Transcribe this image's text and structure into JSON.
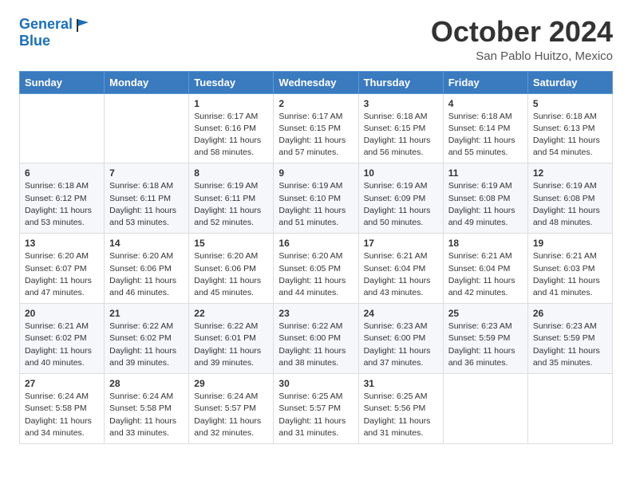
{
  "header": {
    "logo_line1": "General",
    "logo_line2": "Blue",
    "month": "October 2024",
    "location": "San Pablo Huitzo, Mexico"
  },
  "weekdays": [
    "Sunday",
    "Monday",
    "Tuesday",
    "Wednesday",
    "Thursday",
    "Friday",
    "Saturday"
  ],
  "weeks": [
    [
      {
        "day": "",
        "sunrise": "",
        "sunset": "",
        "daylight": ""
      },
      {
        "day": "",
        "sunrise": "",
        "sunset": "",
        "daylight": ""
      },
      {
        "day": "1",
        "sunrise": "Sunrise: 6:17 AM",
        "sunset": "Sunset: 6:16 PM",
        "daylight": "Daylight: 11 hours and 58 minutes."
      },
      {
        "day": "2",
        "sunrise": "Sunrise: 6:17 AM",
        "sunset": "Sunset: 6:15 PM",
        "daylight": "Daylight: 11 hours and 57 minutes."
      },
      {
        "day": "3",
        "sunrise": "Sunrise: 6:18 AM",
        "sunset": "Sunset: 6:15 PM",
        "daylight": "Daylight: 11 hours and 56 minutes."
      },
      {
        "day": "4",
        "sunrise": "Sunrise: 6:18 AM",
        "sunset": "Sunset: 6:14 PM",
        "daylight": "Daylight: 11 hours and 55 minutes."
      },
      {
        "day": "5",
        "sunrise": "Sunrise: 6:18 AM",
        "sunset": "Sunset: 6:13 PM",
        "daylight": "Daylight: 11 hours and 54 minutes."
      }
    ],
    [
      {
        "day": "6",
        "sunrise": "Sunrise: 6:18 AM",
        "sunset": "Sunset: 6:12 PM",
        "daylight": "Daylight: 11 hours and 53 minutes."
      },
      {
        "day": "7",
        "sunrise": "Sunrise: 6:18 AM",
        "sunset": "Sunset: 6:11 PM",
        "daylight": "Daylight: 11 hours and 53 minutes."
      },
      {
        "day": "8",
        "sunrise": "Sunrise: 6:19 AM",
        "sunset": "Sunset: 6:11 PM",
        "daylight": "Daylight: 11 hours and 52 minutes."
      },
      {
        "day": "9",
        "sunrise": "Sunrise: 6:19 AM",
        "sunset": "Sunset: 6:10 PM",
        "daylight": "Daylight: 11 hours and 51 minutes."
      },
      {
        "day": "10",
        "sunrise": "Sunrise: 6:19 AM",
        "sunset": "Sunset: 6:09 PM",
        "daylight": "Daylight: 11 hours and 50 minutes."
      },
      {
        "day": "11",
        "sunrise": "Sunrise: 6:19 AM",
        "sunset": "Sunset: 6:08 PM",
        "daylight": "Daylight: 11 hours and 49 minutes."
      },
      {
        "day": "12",
        "sunrise": "Sunrise: 6:19 AM",
        "sunset": "Sunset: 6:08 PM",
        "daylight": "Daylight: 11 hours and 48 minutes."
      }
    ],
    [
      {
        "day": "13",
        "sunrise": "Sunrise: 6:20 AM",
        "sunset": "Sunset: 6:07 PM",
        "daylight": "Daylight: 11 hours and 47 minutes."
      },
      {
        "day": "14",
        "sunrise": "Sunrise: 6:20 AM",
        "sunset": "Sunset: 6:06 PM",
        "daylight": "Daylight: 11 hours and 46 minutes."
      },
      {
        "day": "15",
        "sunrise": "Sunrise: 6:20 AM",
        "sunset": "Sunset: 6:06 PM",
        "daylight": "Daylight: 11 hours and 45 minutes."
      },
      {
        "day": "16",
        "sunrise": "Sunrise: 6:20 AM",
        "sunset": "Sunset: 6:05 PM",
        "daylight": "Daylight: 11 hours and 44 minutes."
      },
      {
        "day": "17",
        "sunrise": "Sunrise: 6:21 AM",
        "sunset": "Sunset: 6:04 PM",
        "daylight": "Daylight: 11 hours and 43 minutes."
      },
      {
        "day": "18",
        "sunrise": "Sunrise: 6:21 AM",
        "sunset": "Sunset: 6:04 PM",
        "daylight": "Daylight: 11 hours and 42 minutes."
      },
      {
        "day": "19",
        "sunrise": "Sunrise: 6:21 AM",
        "sunset": "Sunset: 6:03 PM",
        "daylight": "Daylight: 11 hours and 41 minutes."
      }
    ],
    [
      {
        "day": "20",
        "sunrise": "Sunrise: 6:21 AM",
        "sunset": "Sunset: 6:02 PM",
        "daylight": "Daylight: 11 hours and 40 minutes."
      },
      {
        "day": "21",
        "sunrise": "Sunrise: 6:22 AM",
        "sunset": "Sunset: 6:02 PM",
        "daylight": "Daylight: 11 hours and 39 minutes."
      },
      {
        "day": "22",
        "sunrise": "Sunrise: 6:22 AM",
        "sunset": "Sunset: 6:01 PM",
        "daylight": "Daylight: 11 hours and 39 minutes."
      },
      {
        "day": "23",
        "sunrise": "Sunrise: 6:22 AM",
        "sunset": "Sunset: 6:00 PM",
        "daylight": "Daylight: 11 hours and 38 minutes."
      },
      {
        "day": "24",
        "sunrise": "Sunrise: 6:23 AM",
        "sunset": "Sunset: 6:00 PM",
        "daylight": "Daylight: 11 hours and 37 minutes."
      },
      {
        "day": "25",
        "sunrise": "Sunrise: 6:23 AM",
        "sunset": "Sunset: 5:59 PM",
        "daylight": "Daylight: 11 hours and 36 minutes."
      },
      {
        "day": "26",
        "sunrise": "Sunrise: 6:23 AM",
        "sunset": "Sunset: 5:59 PM",
        "daylight": "Daylight: 11 hours and 35 minutes."
      }
    ],
    [
      {
        "day": "27",
        "sunrise": "Sunrise: 6:24 AM",
        "sunset": "Sunset: 5:58 PM",
        "daylight": "Daylight: 11 hours and 34 minutes."
      },
      {
        "day": "28",
        "sunrise": "Sunrise: 6:24 AM",
        "sunset": "Sunset: 5:58 PM",
        "daylight": "Daylight: 11 hours and 33 minutes."
      },
      {
        "day": "29",
        "sunrise": "Sunrise: 6:24 AM",
        "sunset": "Sunset: 5:57 PM",
        "daylight": "Daylight: 11 hours and 32 minutes."
      },
      {
        "day": "30",
        "sunrise": "Sunrise: 6:25 AM",
        "sunset": "Sunset: 5:57 PM",
        "daylight": "Daylight: 11 hours and 31 minutes."
      },
      {
        "day": "31",
        "sunrise": "Sunrise: 6:25 AM",
        "sunset": "Sunset: 5:56 PM",
        "daylight": "Daylight: 11 hours and 31 minutes."
      },
      {
        "day": "",
        "sunrise": "",
        "sunset": "",
        "daylight": ""
      },
      {
        "day": "",
        "sunrise": "",
        "sunset": "",
        "daylight": ""
      }
    ]
  ]
}
